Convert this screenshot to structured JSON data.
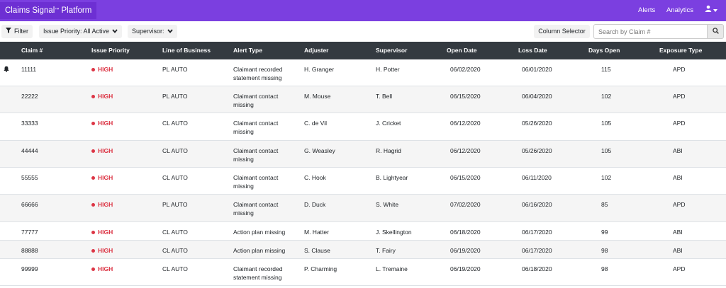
{
  "app": {
    "brand_name": "Claims Signal",
    "brand_tm": "™",
    "brand_suffix": " Platform",
    "brand_color": "#7b3fe0"
  },
  "nav": {
    "alerts": "Alerts",
    "analytics": "Analytics",
    "user_icon": "user-icon"
  },
  "toolbar": {
    "filter_label": "Filter",
    "priority_label": "Issue Priority: All Active",
    "supervisor_label": "Supervisor:",
    "column_selector_label": "Column Selector",
    "search_placeholder": "Search by Claim #",
    "search_icon": "search-icon"
  },
  "table": {
    "headers": [
      "Claim #",
      "Issue Priority",
      "Line of Business",
      "Alert Type",
      "Adjuster",
      "Supervisor",
      "Open Date",
      "Loss Date",
      "Days Open",
      "Exposure Type"
    ],
    "rows": [
      {
        "claim": "11111",
        "priority": "HIGH",
        "lob": "PL AUTO",
        "alert": "Claimant recorded statement missing",
        "adjuster": "H. Granger",
        "supervisor": "H. Potter",
        "open": "06/02/2020",
        "loss": "06/01/2020",
        "days": "115",
        "exposure": "APD",
        "bell": true
      },
      {
        "claim": "22222",
        "priority": "HIGH",
        "lob": "PL AUTO",
        "alert": "Claimant contact missing",
        "adjuster": "M. Mouse",
        "supervisor": "T. Bell",
        "open": "06/15/2020",
        "loss": "06/04/2020",
        "days": "102",
        "exposure": "APD"
      },
      {
        "claim": "33333",
        "priority": "HIGH",
        "lob": "CL AUTO",
        "alert": "Claimant contact missing",
        "adjuster": "C. de Vil",
        "supervisor": "J. Cricket",
        "open": "06/12/2020",
        "loss": "05/26/2020",
        "days": "105",
        "exposure": "APD"
      },
      {
        "claim": "44444",
        "priority": "HIGH",
        "lob": "CL AUTO",
        "alert": "Claimant contact missing",
        "adjuster": "G. Weasley",
        "supervisor": "R. Hagrid",
        "open": "06/12/2020",
        "loss": "05/26/2020",
        "days": "105",
        "exposure": "ABI"
      },
      {
        "claim": "55555",
        "priority": "HIGH",
        "lob": "CL AUTO",
        "alert": "Claimant contact missing",
        "adjuster": "C. Hook",
        "supervisor": "B. Lightyear",
        "open": "06/15/2020",
        "loss": "06/11/2020",
        "days": "102",
        "exposure": "ABI"
      },
      {
        "claim": "66666",
        "priority": "HIGH",
        "lob": "PL AUTO",
        "alert": "Claimant contact missing",
        "adjuster": "D. Duck",
        "supervisor": "S. White",
        "open": "07/02/2020",
        "loss": "06/16/2020",
        "days": "85",
        "exposure": "APD"
      },
      {
        "claim": "77777",
        "priority": "HIGH",
        "lob": "CL AUTO",
        "alert": "Action plan missing",
        "adjuster": "M. Hatter",
        "supervisor": "J. Skellington",
        "open": "06/18/2020",
        "loss": "06/17/2020",
        "days": "99",
        "exposure": "ABI"
      },
      {
        "claim": "88888",
        "priority": "HIGH",
        "lob": "CL AUTO",
        "alert": "Action plan missing",
        "adjuster": "S. Clause",
        "supervisor": "T. Fairy",
        "open": "06/19/2020",
        "loss": "06/17/2020",
        "days": "98",
        "exposure": "ABI"
      },
      {
        "claim": "99999",
        "priority": "HIGH",
        "lob": "CL AUTO",
        "alert": "Claimant recorded statement missing",
        "adjuster": "P. Charming",
        "supervisor": "L. Tremaine",
        "open": "06/19/2020",
        "loss": "06/18/2020",
        "days": "98",
        "exposure": "APD"
      }
    ]
  },
  "colors": {
    "header_bg": "#343a40",
    "priority_high": "#dc3545"
  }
}
